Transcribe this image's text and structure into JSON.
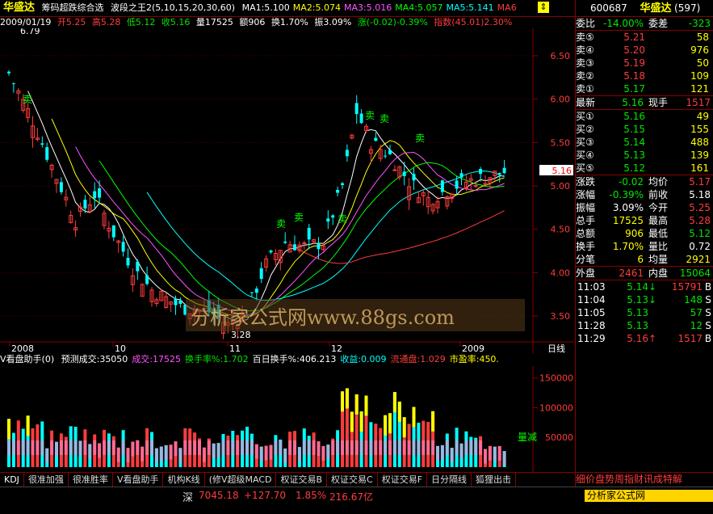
{
  "title": {
    "stock_name": "华盛达",
    "formula_name": "筹码超跌综合选",
    "indicator_name": "波段之王2(5,10,15,20,30,60)",
    "ma": [
      {
        "label": "MA1:5.100",
        "color": "#ffffff"
      },
      {
        "label": "MA2:5.074",
        "color": "#ffff00"
      },
      {
        "label": "MA3:5.016",
        "color": "#ff55ff"
      },
      {
        "label": "MA4:5.057",
        "color": "#00ff00"
      },
      {
        "label": "MA5:5.141",
        "color": "#00ffff"
      },
      {
        "label": "MA6",
        "color": "#ff3c3c"
      }
    ]
  },
  "info": {
    "date": "2009/01/19",
    "open": "开5.25",
    "high": "高5.28",
    "low": "低5.12",
    "close": "收5.16",
    "volume": "量17525",
    "amount": "额906",
    "turnover": "换1.70%",
    "amplitude": "振3.09%",
    "change": "涨(-0.02)-0.39%",
    "index": "指数(45.01)2.30%"
  },
  "price_axis": {
    "ticks": [
      "6.50",
      "6.00",
      "5.50",
      "5.00",
      "4.50",
      "4.00",
      "3.50"
    ],
    "current": "5.16",
    "high_mark": "6.79",
    "low_mark": "3.28"
  },
  "time_axis": {
    "labels": [
      "2008",
      "10",
      "11",
      "12",
      "2009"
    ],
    "period": "日线"
  },
  "watermark": "分析家公式网www.88gs.com",
  "signals": [
    "卖",
    "卖",
    "卖",
    "卖",
    "卖",
    "卖",
    "卖"
  ],
  "volume_panel": {
    "title": "V看盘助手(0)",
    "items": [
      {
        "text": "预测成交:35050",
        "color": "#ffffff"
      },
      {
        "text": "成交:17525",
        "color": "#ff55ff"
      },
      {
        "text": "换手率%:1.702",
        "color": "#00e600"
      },
      {
        "text": "百日换手%:406.213",
        "color": "#ffffff"
      },
      {
        "text": "收益:0.009",
        "color": "#00ffff"
      },
      {
        "text": "流通盘:1.029",
        "color": "#ff3c3c"
      },
      {
        "text": "市盈率:450.",
        "color": "#ffff00"
      }
    ],
    "ticks": [
      "150000",
      "100000",
      "50000"
    ],
    "side_label": "量减"
  },
  "tabs": [
    "KDJ",
    "很准加强",
    "很准胜率",
    "V看盘助手",
    "机构K线",
    "(修V超级MACD",
    "权证交易B",
    "权证交易C",
    "权证交易F",
    "日分隔线",
    "狐狸出击"
  ],
  "status": {
    "market": "深",
    "index": "7045.18",
    "change": "+127.70",
    "percent": "1.85%",
    "amount": "216.67亿",
    "brand": "分析家公式网 www.88gs.com"
  },
  "quote": {
    "code": "600687",
    "name": "华盛达",
    "count": "(597)",
    "weibi_label": "委比",
    "weibi": "-14.00%",
    "weicha_label": "委差",
    "weicha": "-323",
    "sell": [
      {
        "label": "卖⑤",
        "price": "5.21",
        "vol": "58"
      },
      {
        "label": "卖④",
        "price": "5.20",
        "vol": "976"
      },
      {
        "label": "卖③",
        "price": "5.19",
        "vol": "50"
      },
      {
        "label": "卖②",
        "price": "5.18",
        "vol": "109"
      },
      {
        "label": "卖①",
        "price": "5.17",
        "vol": "121"
      }
    ],
    "latest_label": "最新",
    "latest": "5.16",
    "xianshou_label": "现手",
    "xianshou": "1517",
    "buy": [
      {
        "label": "买①",
        "price": "5.16",
        "vol": "49"
      },
      {
        "label": "买②",
        "price": "5.15",
        "vol": "155"
      },
      {
        "label": "买③",
        "price": "5.14",
        "vol": "488"
      },
      {
        "label": "买④",
        "price": "5.13",
        "vol": "139"
      },
      {
        "label": "买⑤",
        "price": "5.12",
        "vol": "161"
      }
    ],
    "stats": [
      {
        "l1": "涨跌",
        "v1": "-0.02",
        "c1": "#00e600",
        "l2": "均价",
        "v2": "5.17",
        "c2": "#ff3c3c"
      },
      {
        "l1": "涨幅",
        "v1": "-0.39%",
        "c1": "#00e600",
        "l2": "前收",
        "v2": "5.18",
        "c2": "#ffffff"
      },
      {
        "l1": "振幅",
        "v1": "3.09%",
        "c1": "#ffffff",
        "l2": "今开",
        "v2": "5.25",
        "c2": "#ff3c3c"
      },
      {
        "l1": "总手",
        "v1": "17525",
        "c1": "#ffff00",
        "l2": "最高",
        "v2": "5.28",
        "c2": "#ff3c3c"
      },
      {
        "l1": "总额",
        "v1": "906",
        "c1": "#ffff00",
        "l2": "最低",
        "v2": "5.12",
        "c2": "#00e600"
      },
      {
        "l1": "换手",
        "v1": "1.70%",
        "c1": "#ffff00",
        "l2": "量比",
        "v2": "0.72",
        "c2": "#ffffff"
      },
      {
        "l1": "分笔",
        "v1": "6",
        "c1": "#ffff00",
        "l2": "均量",
        "v2": "2921",
        "c2": "#ffff00"
      }
    ],
    "waipan_label": "外盘",
    "waipan": "2461",
    "neipan_label": "内盘",
    "neipan": "15064",
    "ticks": [
      {
        "time": "11:03",
        "price": "5.14",
        "arrow": "↓",
        "vol": "15791",
        "bs": "B",
        "pc": "#00e600",
        "vc": "#ff3c3c"
      },
      {
        "time": "11:04",
        "price": "5.13",
        "arrow": "↓",
        "vol": "148",
        "bs": "S",
        "pc": "#00e600",
        "vc": "#00e600"
      },
      {
        "time": "11:05",
        "price": "5.13",
        "arrow": "",
        "vol": "57",
        "bs": "S",
        "pc": "#00e600",
        "vc": "#00e600"
      },
      {
        "time": "11:28",
        "price": "5.13",
        "arrow": "",
        "vol": "12",
        "bs": "S",
        "pc": "#00e600",
        "vc": "#00e600"
      },
      {
        "time": "11:29",
        "price": "5.16",
        "arrow": "↑",
        "vol": "1517",
        "bs": "B",
        "pc": "#ff3c3c",
        "vc": "#ff3c3c"
      }
    ],
    "bottom_bar": "细价盘势周指财讯成特解"
  }
}
